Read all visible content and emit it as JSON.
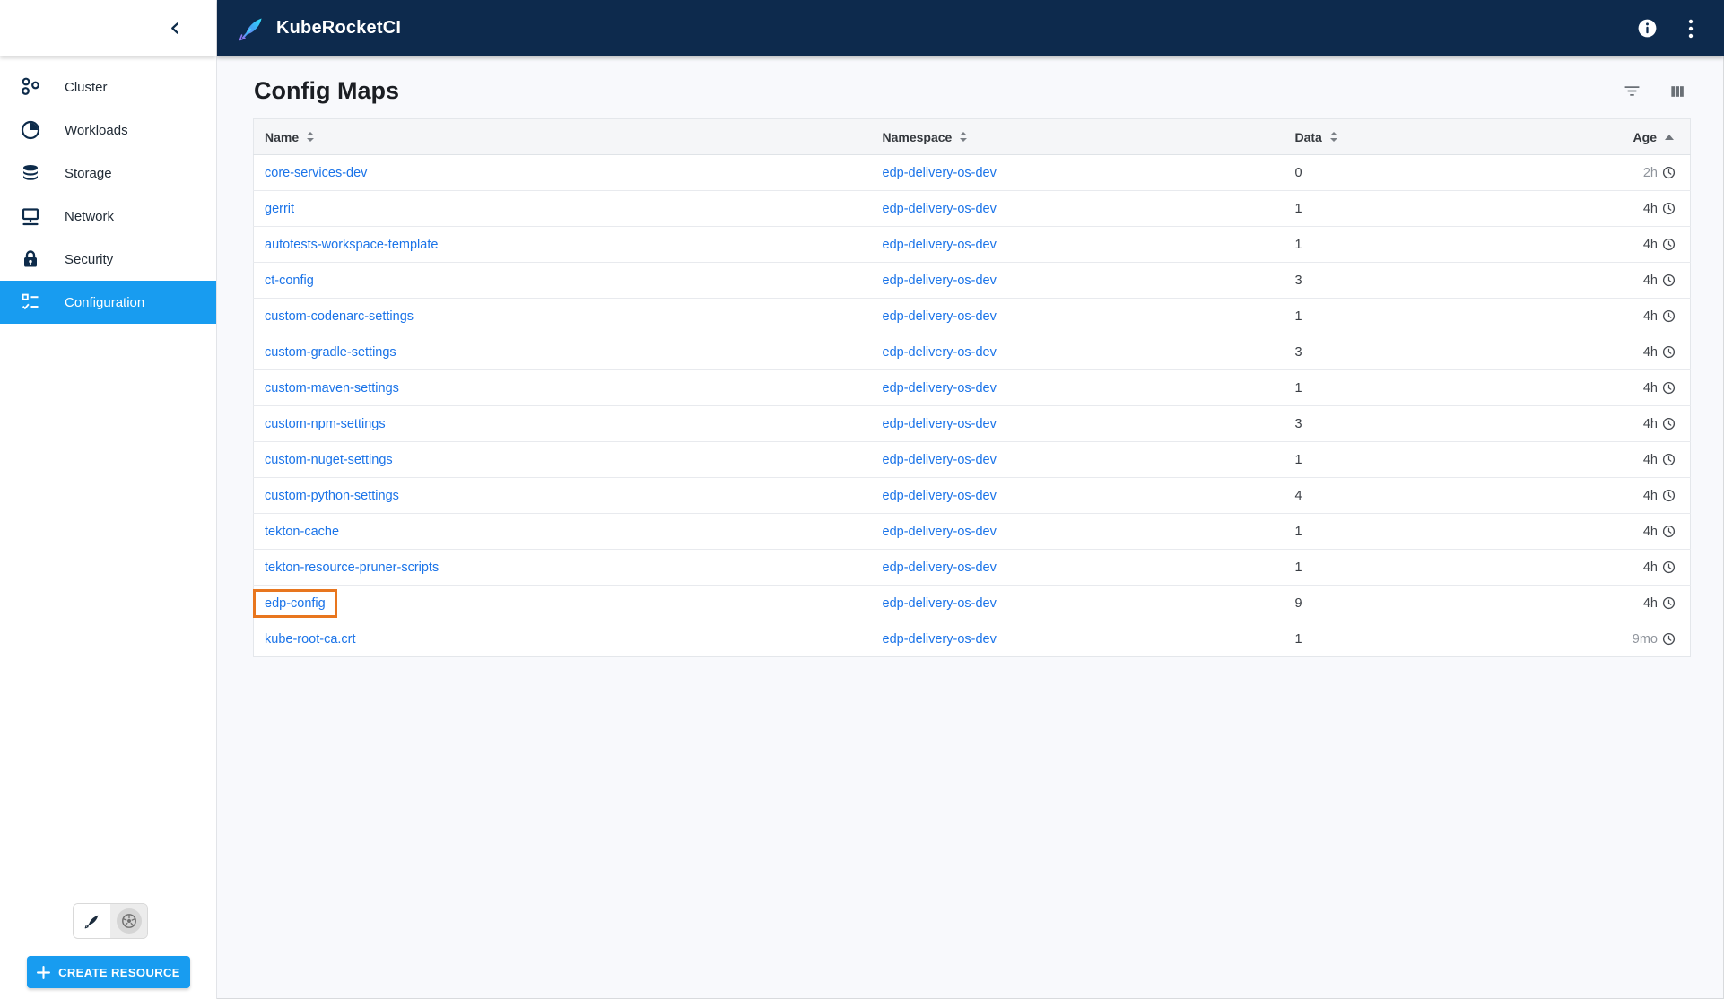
{
  "app_bar": {
    "title": "KubeRocketCI",
    "logo_icon": "rocket-quill-icon",
    "actions": [
      {
        "icon": "info-icon"
      },
      {
        "icon": "kebab-menu-icon"
      }
    ]
  },
  "sidebar": {
    "collapse_icon": "chevron-left-icon",
    "items": [
      {
        "label": "Cluster",
        "icon": "cluster-icon",
        "selected": false
      },
      {
        "label": "Workloads",
        "icon": "workloads-icon",
        "selected": false
      },
      {
        "label": "Storage",
        "icon": "storage-icon",
        "selected": false
      },
      {
        "label": "Network",
        "icon": "network-icon",
        "selected": false
      },
      {
        "label": "Security",
        "icon": "security-icon",
        "selected": false
      },
      {
        "label": "Configuration",
        "icon": "configuration-icon",
        "selected": true
      }
    ],
    "theme_switcher": [
      {
        "icon": "quill-theme-icon",
        "active": false
      },
      {
        "icon": "kubernetes-wheel-icon",
        "active": true
      }
    ],
    "create_resource_label": "CREATE RESOURCE",
    "create_resource_icon": "plus-icon"
  },
  "page": {
    "title": "Config Maps",
    "toolbar": [
      {
        "icon": "filter-icon"
      },
      {
        "icon": "columns-icon"
      }
    ]
  },
  "table": {
    "columns": [
      {
        "label": "Name",
        "sort": "both"
      },
      {
        "label": "Namespace",
        "sort": "both"
      },
      {
        "label": "Data",
        "sort": "both"
      },
      {
        "label": "Age",
        "sort": "asc"
      }
    ],
    "rows": [
      {
        "name": "core-services-dev",
        "namespace": "edp-delivery-os-dev",
        "data": "0",
        "age": "2h",
        "age_tone": "light",
        "highlighted": false
      },
      {
        "name": "gerrit",
        "namespace": "edp-delivery-os-dev",
        "data": "1",
        "age": "4h",
        "age_tone": "dark",
        "highlighted": false
      },
      {
        "name": "autotests-workspace-template",
        "namespace": "edp-delivery-os-dev",
        "data": "1",
        "age": "4h",
        "age_tone": "dark",
        "highlighted": false
      },
      {
        "name": "ct-config",
        "namespace": "edp-delivery-os-dev",
        "data": "3",
        "age": "4h",
        "age_tone": "dark",
        "highlighted": false
      },
      {
        "name": "custom-codenarc-settings",
        "namespace": "edp-delivery-os-dev",
        "data": "1",
        "age": "4h",
        "age_tone": "dark",
        "highlighted": false
      },
      {
        "name": "custom-gradle-settings",
        "namespace": "edp-delivery-os-dev",
        "data": "3",
        "age": "4h",
        "age_tone": "dark",
        "highlighted": false
      },
      {
        "name": "custom-maven-settings",
        "namespace": "edp-delivery-os-dev",
        "data": "1",
        "age": "4h",
        "age_tone": "dark",
        "highlighted": false
      },
      {
        "name": "custom-npm-settings",
        "namespace": "edp-delivery-os-dev",
        "data": "3",
        "age": "4h",
        "age_tone": "dark",
        "highlighted": false
      },
      {
        "name": "custom-nuget-settings",
        "namespace": "edp-delivery-os-dev",
        "data": "1",
        "age": "4h",
        "age_tone": "dark",
        "highlighted": false
      },
      {
        "name": "custom-python-settings",
        "namespace": "edp-delivery-os-dev",
        "data": "4",
        "age": "4h",
        "age_tone": "dark",
        "highlighted": false
      },
      {
        "name": "tekton-cache",
        "namespace": "edp-delivery-os-dev",
        "data": "1",
        "age": "4h",
        "age_tone": "dark",
        "highlighted": false
      },
      {
        "name": "tekton-resource-pruner-scripts",
        "namespace": "edp-delivery-os-dev",
        "data": "1",
        "age": "4h",
        "age_tone": "dark",
        "highlighted": false
      },
      {
        "name": "edp-config",
        "namespace": "edp-delivery-os-dev",
        "data": "9",
        "age": "4h",
        "age_tone": "dark",
        "highlighted": true
      },
      {
        "name": "kube-root-ca.crt",
        "namespace": "edp-delivery-os-dev",
        "data": "1",
        "age": "9mo",
        "age_tone": "light",
        "highlighted": false
      }
    ],
    "age_clock_icon": "clock-icon"
  },
  "colors": {
    "accent": "#189cf0",
    "appbar_bg": "#0d2a4d",
    "link": "#1a73e8",
    "highlight_border": "#e8761e",
    "sidebar_icon": "#0d2b4a"
  }
}
